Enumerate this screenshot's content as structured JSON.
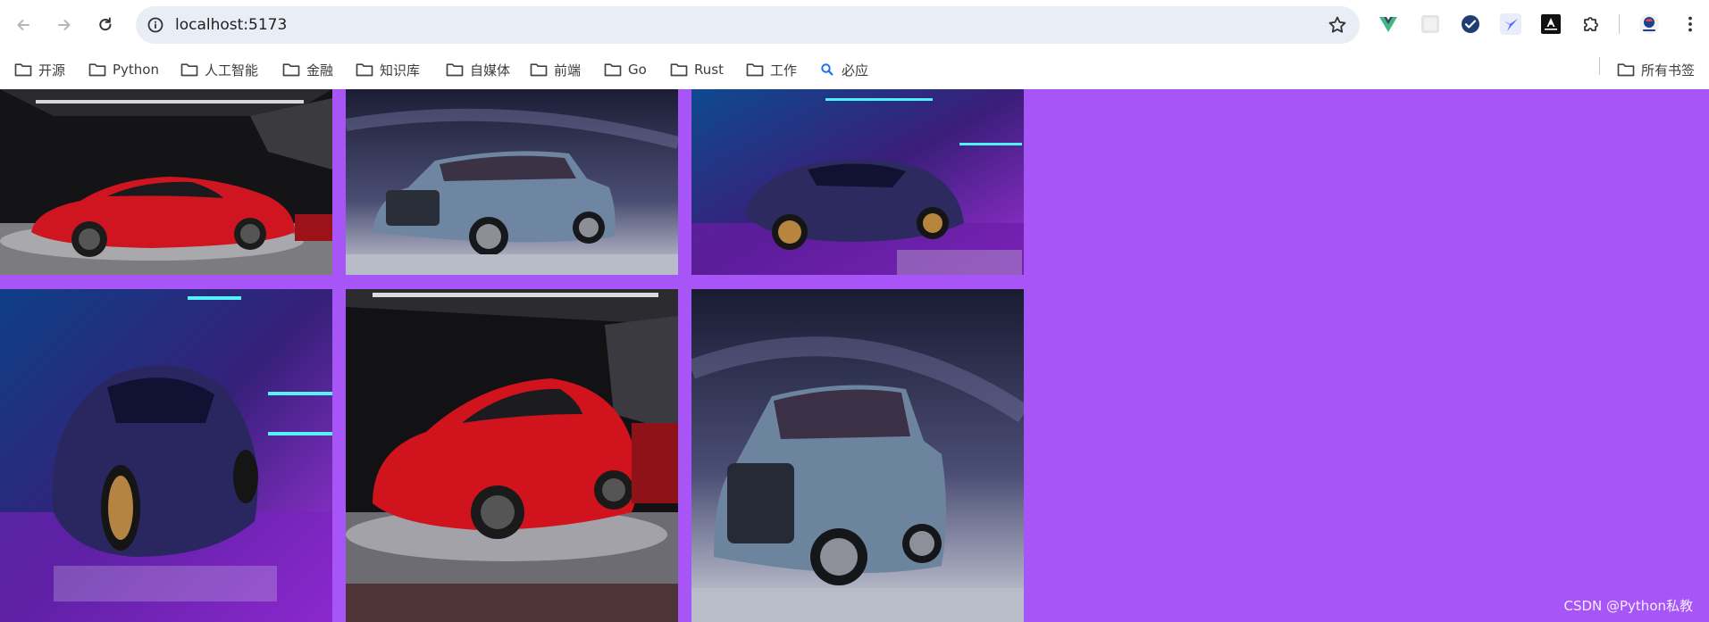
{
  "browser": {
    "url": "localhost:5173",
    "icons": {
      "back": "arrow-left-icon",
      "forward": "arrow-right-icon",
      "reload": "reload-icon",
      "site_info": "info-icon",
      "bookmark_star": "star-icon",
      "extensions": "puzzle-icon",
      "menu": "three-dots-icon"
    }
  },
  "bookmarks": {
    "items": [
      {
        "label": "开源"
      },
      {
        "label": "Python"
      },
      {
        "label": "人工智能"
      },
      {
        "label": "金融"
      },
      {
        "label": "知识库"
      },
      {
        "label": "自媒体"
      },
      {
        "label": "前端"
      },
      {
        "label": "Go"
      },
      {
        "label": "Rust"
      },
      {
        "label": "工作"
      },
      {
        "label": "必应"
      }
    ],
    "all_bookmarks_label": "所有书签"
  },
  "page": {
    "background": "#a855f7",
    "images": [
      {
        "subject": "red-sports-car"
      },
      {
        "subject": "blue-suv"
      },
      {
        "subject": "purple-hypercar"
      },
      {
        "subject": "purple-hypercar"
      },
      {
        "subject": "red-sports-car"
      },
      {
        "subject": "blue-suv"
      }
    ],
    "watermark": "CSDN @Python私教"
  }
}
